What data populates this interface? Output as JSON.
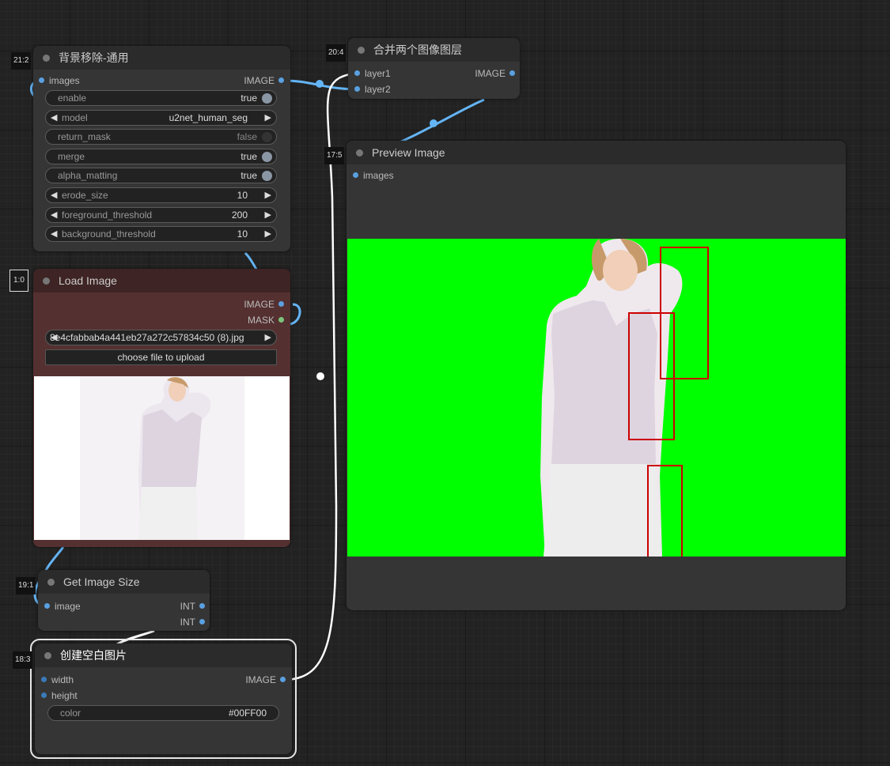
{
  "colors": {
    "canvas": "#222222",
    "node_body": "#353535",
    "node_title": "#2b2b2b",
    "load_image_body": "#553030",
    "link_image": "#64b5f6",
    "link_selected": "#ffffff",
    "preview_bg": "#00ff00",
    "annotation_box": "#cc0000"
  },
  "nodes": {
    "bg_remove": {
      "id": "21:2",
      "title": "背景移除-通用",
      "input_images": "images",
      "output_image": "IMAGE",
      "widgets": [
        {
          "label": "enable",
          "value": "true",
          "kind": "toggle",
          "on": true
        },
        {
          "label": "model",
          "value": "u2net_human_seg",
          "kind": "combo"
        },
        {
          "label": "return_mask",
          "value": "false",
          "kind": "toggle",
          "on": false
        },
        {
          "label": "merge",
          "value": "true",
          "kind": "toggle",
          "on": true
        },
        {
          "label": "alpha_matting",
          "value": "true",
          "kind": "toggle",
          "on": true
        },
        {
          "label": "erode_size",
          "value": "10",
          "kind": "combo"
        },
        {
          "label": "foreground_threshold",
          "value": "200",
          "kind": "combo"
        },
        {
          "label": "background_threshold",
          "value": "10",
          "kind": "combo"
        }
      ]
    },
    "merge_layers": {
      "id": "20:4",
      "title": "合并两个图像图层",
      "input_layer1": "layer1",
      "input_layer2": "layer2",
      "output_image": "IMAGE"
    },
    "preview": {
      "id": "17:5",
      "title": "Preview Image",
      "input_images": "images"
    },
    "load_image": {
      "id": "1:0",
      "title": "Load Image",
      "output_image": "IMAGE",
      "output_mask": "MASK",
      "file": "8e4cfabbab4a441eb27a272c57834c50 (8).jpg",
      "upload_label": "choose file to upload"
    },
    "image_size": {
      "id": "19:1",
      "title": "Get Image Size",
      "input_image": "image",
      "output_int_1": "INT",
      "output_int_2": "INT"
    },
    "blank_image": {
      "id": "18:3",
      "title": "创建空白图片",
      "input_width": "width",
      "input_height": "height",
      "output_image": "IMAGE",
      "color_label": "color",
      "color_value": "#00FF00"
    }
  }
}
